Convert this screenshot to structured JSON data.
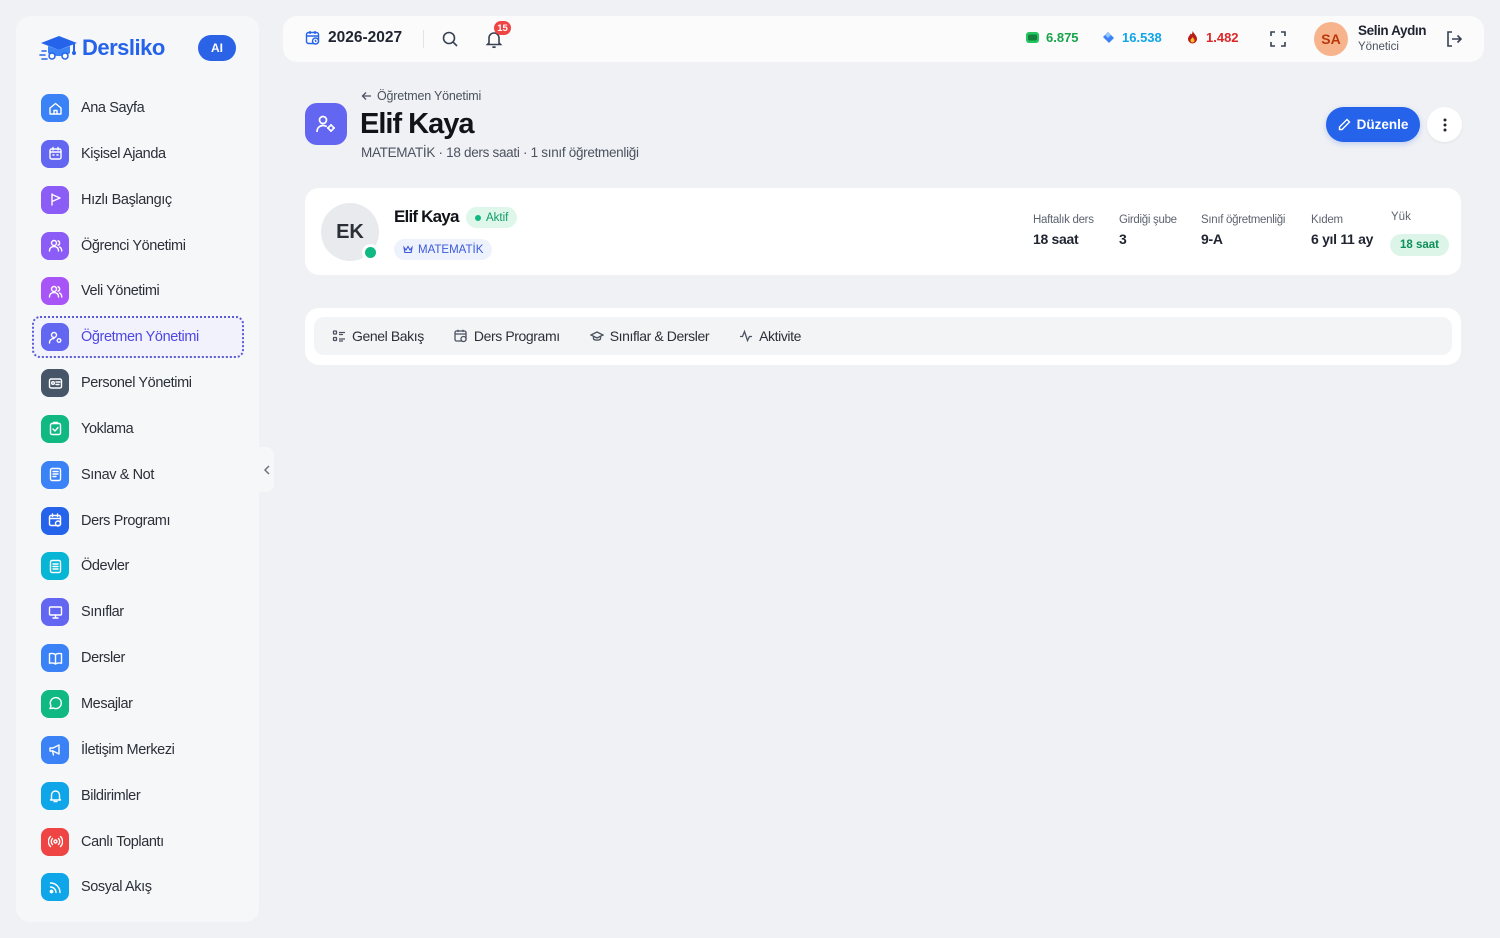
{
  "brand": {
    "name": "Dersliko",
    "ai_label": "AI"
  },
  "sidebar": {
    "items": [
      {
        "label": "Ana Sayfa",
        "icon": "home-icon",
        "color": "#3b82f6"
      },
      {
        "label": "Kişisel Ajanda",
        "icon": "calendar-icon",
        "color": "#6366f1"
      },
      {
        "label": "Hızlı Başlangıç",
        "icon": "flag-icon",
        "color": "#8b5cf6"
      },
      {
        "label": "Öğrenci Yönetimi",
        "icon": "users-icon",
        "color": "#8b5cf6"
      },
      {
        "label": "Veli Yönetimi",
        "icon": "users-icon",
        "color": "#a855f7"
      },
      {
        "label": "Öğretmen Yönetimi",
        "icon": "teacher-icon",
        "color": "#6366f1",
        "active": true
      },
      {
        "label": "Personel Yönetimi",
        "icon": "id-card-icon",
        "color": "#475569"
      },
      {
        "label": "Yoklama",
        "icon": "clipboard-check-icon",
        "color": "#10b981"
      },
      {
        "label": "Sınav & Not",
        "icon": "exam-icon",
        "color": "#3b82f6"
      },
      {
        "label": "Ders Programı",
        "icon": "schedule-icon",
        "color": "#2563eb"
      },
      {
        "label": "Ödevler",
        "icon": "homework-icon",
        "color": "#06b6d4"
      },
      {
        "label": "Sınıflar",
        "icon": "presentation-icon",
        "color": "#6366f1"
      },
      {
        "label": "Dersler",
        "icon": "book-icon",
        "color": "#3b82f6"
      },
      {
        "label": "Mesajlar",
        "icon": "message-icon",
        "color": "#10b981"
      },
      {
        "label": "İletişim Merkezi",
        "icon": "megaphone-icon",
        "color": "#3b82f6"
      },
      {
        "label": "Bildirimler",
        "icon": "bell-icon",
        "color": "#0ea5e9"
      },
      {
        "label": "Canlı Toplantı",
        "icon": "broadcast-icon",
        "color": "#ef4444"
      },
      {
        "label": "Sosyal Akış",
        "icon": "rss-icon",
        "color": "#0ea5e9"
      }
    ]
  },
  "topbar": {
    "year": "2026-2027",
    "notification_count": "15",
    "stats": [
      {
        "value": "6.875",
        "icon": "money-icon",
        "color": "#16a34a"
      },
      {
        "value": "16.538",
        "icon": "diamond-icon",
        "color": "#0ea5e9"
      },
      {
        "value": "1.482",
        "icon": "flame-icon",
        "color": "#dc2626"
      }
    ],
    "user": {
      "initials": "SA",
      "name": "Selin Aydın",
      "role": "Yönetici"
    }
  },
  "header": {
    "breadcrumb": "Öğretmen Yönetimi",
    "title": "Elif Kaya",
    "subtitle": "MATEMATİK · 18 ders saati · 1 sınıf öğretmenliği",
    "edit_label": "Düzenle"
  },
  "profile": {
    "initials": "EK",
    "name": "Elif Kaya",
    "status": "Aktif",
    "subject": "MATEMATİK",
    "metrics": [
      {
        "label": "Haftalık ders",
        "value": "18 saat"
      },
      {
        "label": "Girdiği şube",
        "value": "3"
      },
      {
        "label": "Sınıf öğretmenliği",
        "value": "9-A"
      },
      {
        "label": "Kıdem",
        "value": "6 yıl 11 ay"
      }
    ],
    "load_label": "Yük",
    "load_value": "18 saat"
  },
  "tabs": [
    {
      "label": "Genel Bakış",
      "icon": "list-icon"
    },
    {
      "label": "Ders Programı",
      "icon": "calendar-clock-icon"
    },
    {
      "label": "Sınıflar & Dersler",
      "icon": "graduation-cap-icon"
    },
    {
      "label": "Aktivite",
      "icon": "activity-icon"
    }
  ]
}
